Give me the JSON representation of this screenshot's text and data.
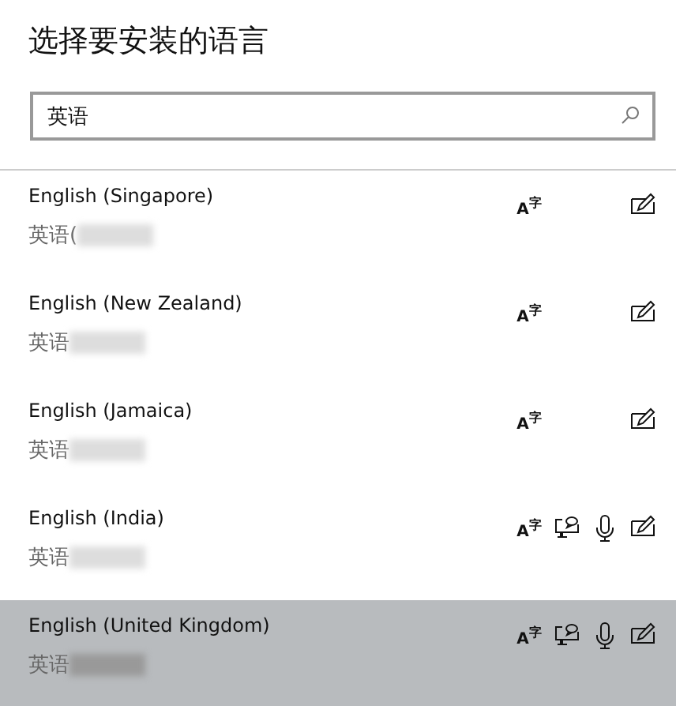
{
  "title": "选择要安装的语言",
  "search": {
    "value": "英语"
  },
  "languages": [
    {
      "name": "English (Singapore)",
      "native": "英语(",
      "selected": false,
      "display": "A$^{字}$",
      "speech": false,
      "voice": false,
      "handwriting": true
    },
    {
      "name": "English (New Zealand)",
      "native": "英语",
      "selected": false,
      "display": "A$^{字}$",
      "speech": false,
      "voice": false,
      "handwriting": true
    },
    {
      "name": "English (Jamaica)",
      "native": "英语",
      "selected": false,
      "display": "A$^{字}$",
      "speech": false,
      "voice": false,
      "handwriting": true
    },
    {
      "name": "English (India)",
      "native": "英语",
      "selected": false,
      "display": "A$^{字}$",
      "speech": true,
      "voice": true,
      "handwriting": true
    },
    {
      "name": "English (United Kingdom)",
      "native": "英语",
      "selected": true,
      "display": "A$^{字}$",
      "speech": true,
      "voice": true,
      "handwriting": true
    }
  ]
}
